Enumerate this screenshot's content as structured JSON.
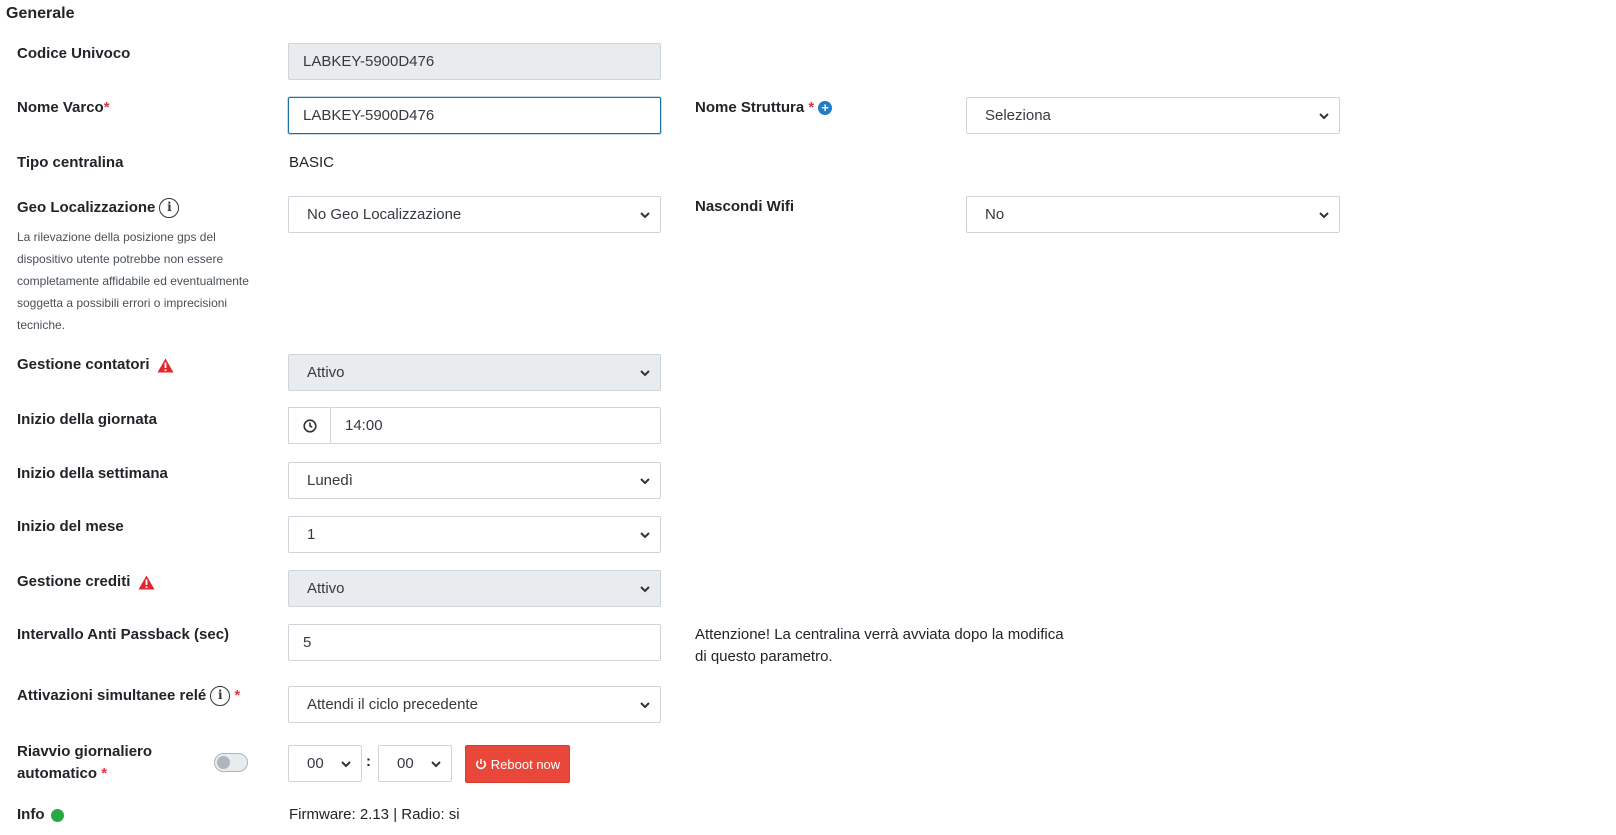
{
  "section": {
    "title": "Generale"
  },
  "fields": {
    "codice": {
      "label": "Codice Univoco",
      "value": "LABKEY-5900D476"
    },
    "nome_varco": {
      "label": "Nome Varco",
      "required": "*",
      "value": "LABKEY-5900D476"
    },
    "nome_struttura": {
      "label": "Nome Struttura",
      "required": "*",
      "value": "Seleziona"
    },
    "tipo_centralina": {
      "label": "Tipo centralina",
      "value": "BASIC"
    },
    "geo": {
      "label": "Geo Localizzazione",
      "help": "La rilevazione della posizione gps del dispositivo utente potrebbe non essere completamente affidabile ed eventualmente soggetta a possibili errori o imprecisioni tecniche.",
      "value": "No Geo Localizzazione"
    },
    "nascondi_wifi": {
      "label": "Nascondi Wifi",
      "value": "No"
    },
    "gestione_contatori": {
      "label": "Gestione contatori",
      "value": "Attivo"
    },
    "inizio_giornata": {
      "label": "Inizio della giornata",
      "value": "14:00"
    },
    "inizio_settimana": {
      "label": "Inizio della settimana",
      "value": "Lunedì"
    },
    "inizio_mese": {
      "label": "Inizio del mese",
      "value": "1"
    },
    "gestione_crediti": {
      "label": "Gestione crediti",
      "value": "Attivo"
    },
    "anti_passback": {
      "label": "Intervallo Anti Passback (sec)",
      "value": "5",
      "note": "Attenzione! La centralina verrà avviata dopo la modifica di questo parametro."
    },
    "attivazioni": {
      "label": "Attivazioni simultanee relé",
      "required": "*",
      "value": "Attendi il ciclo precedente"
    },
    "riavvio": {
      "label_line1": "Riavvio giornaliero",
      "label_line2": "automatico",
      "required": "*",
      "hour": "00",
      "separator": ":",
      "minute": "00",
      "button": "Reboot now"
    },
    "info": {
      "label": "Info",
      "value": "Firmware: 2.13 | Radio: si"
    }
  },
  "icons": {
    "info": "info-circle-icon",
    "warning": "warning-triangle-icon",
    "plus": "plus-circle-icon",
    "clock": "clock-icon",
    "power": "power-icon",
    "chevron": "chevron-down-icon",
    "status": "status-dot-icon"
  },
  "colors": {
    "accent": "#1f7fc4",
    "danger": "#e8473a",
    "status_ok": "#28a745",
    "required": "#dc3545"
  }
}
